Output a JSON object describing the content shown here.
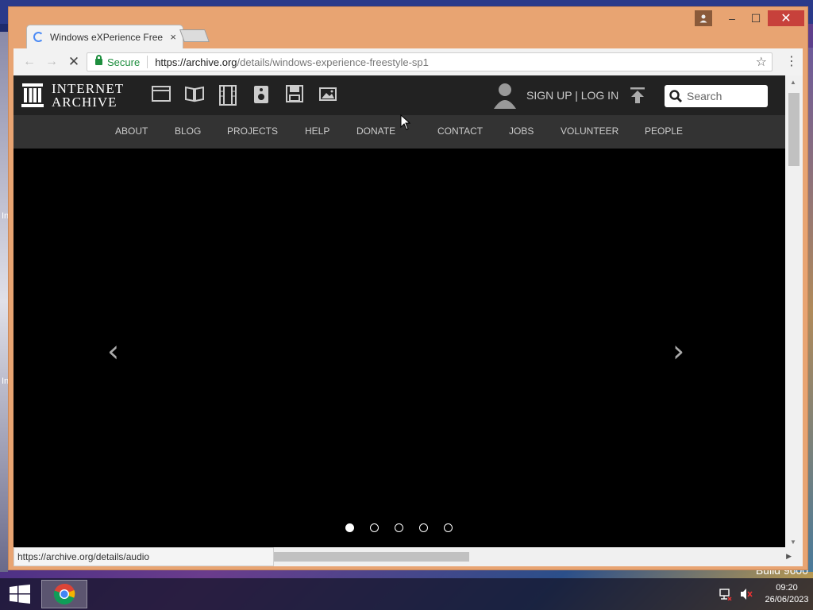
{
  "window": {
    "tab_title": "Windows eXPerience Free",
    "close_glyph": "×",
    "minimize_glyph": "–",
    "maximize_glyph": "☐",
    "win_close_glyph": "✕"
  },
  "toolbar": {
    "back_glyph": "←",
    "forward_glyph": "→",
    "reload_glyph": "✕",
    "secure_label": "Secure",
    "url_domain": "https://archive.org",
    "url_path": "/details/windows-experience-freestyle-sp1",
    "star_glyph": "☆",
    "menu_glyph": "⋮"
  },
  "site": {
    "logo_line1": "INTERNET",
    "logo_line2": "ARCHIVE",
    "media_icons": [
      "web-icon",
      "texts-icon",
      "video-icon",
      "audio-icon",
      "software-icon",
      "images-icon"
    ],
    "signup_label": "SIGN UP | LOG IN",
    "search_placeholder": "Search",
    "nav": [
      "ABOUT",
      "BLOG",
      "PROJECTS",
      "HELP",
      "DONATE",
      "CONTACT",
      "JOBS",
      "VOLUNTEER",
      "PEOPLE"
    ],
    "carousel_prev": "‹",
    "carousel_next": "›",
    "carousel_slide_count": 5,
    "carousel_active_index": 0
  },
  "status": {
    "hover_url": "https://archive.org/details/audio"
  },
  "desktop": {
    "build_text": "Build 9600",
    "side_text": "In"
  },
  "taskbar": {
    "time": "09:20",
    "date": "26/06/2023"
  },
  "colors": {
    "window_frame": "#e8a472",
    "close_button": "#c7413b",
    "site_header": "#222222",
    "site_nav": "#333333",
    "secure_green": "#1e8e3e"
  }
}
